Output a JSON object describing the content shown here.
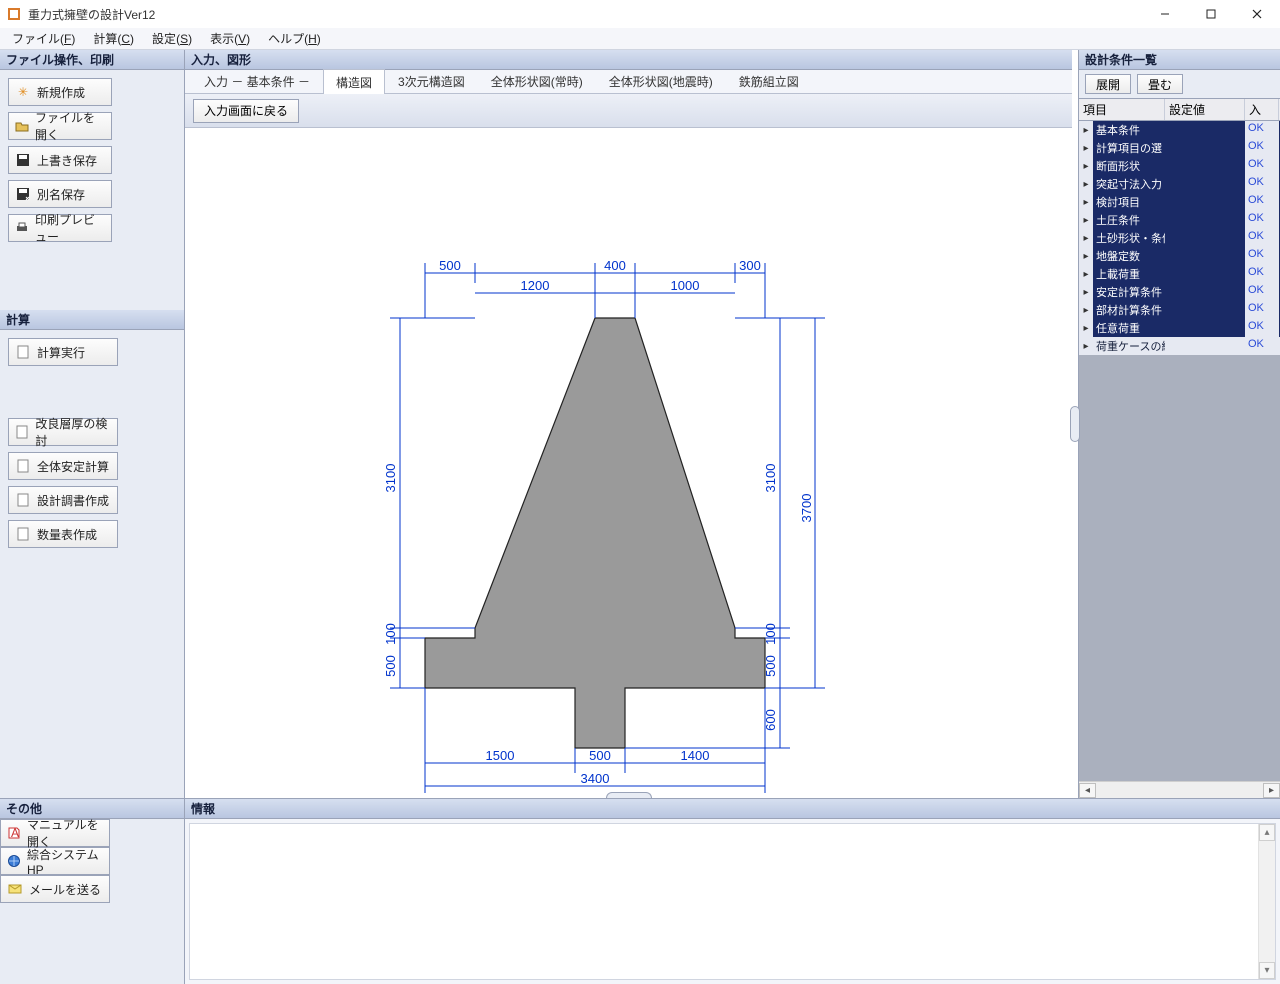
{
  "titlebar": {
    "title": "重力式擁壁の設計Ver12"
  },
  "menubar": {
    "file": "ファイル",
    "file_acc": "F",
    "calc": "計算",
    "calc_acc": "C",
    "settings": "設定",
    "settings_acc": "S",
    "view": "表示",
    "view_acc": "V",
    "help": "ヘルプ",
    "help_acc": "H"
  },
  "left": {
    "section_file": "ファイル操作、印刷",
    "btn_new": "新規作成",
    "btn_open": "ファイルを開く",
    "btn_save": "上書き保存",
    "btn_saveas": "別名保存",
    "btn_print": "印刷プレビュー",
    "section_calc": "計算",
    "btn_run": "計算実行",
    "btn_layer": "改良層厚の検討",
    "btn_stable": "全体安定計算",
    "btn_report": "設計調書作成",
    "btn_qty": "数量表作成"
  },
  "center": {
    "header": "入力、図形",
    "tabs": {
      "t0": "入力 － 基本条件 －",
      "t1": "構造図",
      "t2": "3次元構造図",
      "t3": "全体形状図(常時)",
      "t4": "全体形状図(地震時)",
      "t5": "鉄筋組立図"
    },
    "back_btn": "入力画面に戻る"
  },
  "right": {
    "header": "設計条件一覧",
    "btn_expand": "展開",
    "btn_collapse": "畳む",
    "col_item": "項目",
    "col_value": "設定値",
    "col_in": "入",
    "ok": "OK",
    "rows": {
      "r0": "基本条件",
      "r1": "計算項目の選",
      "r2": "断面形状",
      "r3": "突起寸法入力",
      "r4": "検討項目",
      "r5": "土圧条件",
      "r6": "土砂形状・条件",
      "r7": "地盤定数",
      "r8": "上載荷重",
      "r9": "安定計算条件",
      "r10": "部材計算条件",
      "r11": "任意荷重",
      "r12": "荷重ケースの編"
    }
  },
  "bottom": {
    "other_header": "その他",
    "btn_manual": "マニュアルを開く",
    "btn_hp": "綜合システムHP",
    "btn_mail": "メールを送る",
    "info_header": "情報"
  },
  "chart_data": {
    "type": "diagram",
    "unit": "mm",
    "top": {
      "d500": "500",
      "d1200": "1200",
      "d400": "400",
      "d1000": "1000",
      "d300": "300"
    },
    "left": {
      "d3100": "3100",
      "d100": "100",
      "d500": "500"
    },
    "right": {
      "d3100": "3100",
      "d100": "100",
      "d500": "500",
      "d3700": "3700",
      "d600": "600"
    },
    "bottom": {
      "d1500": "1500",
      "d500": "500",
      "d1400": "1400",
      "d3400": "3400"
    }
  }
}
